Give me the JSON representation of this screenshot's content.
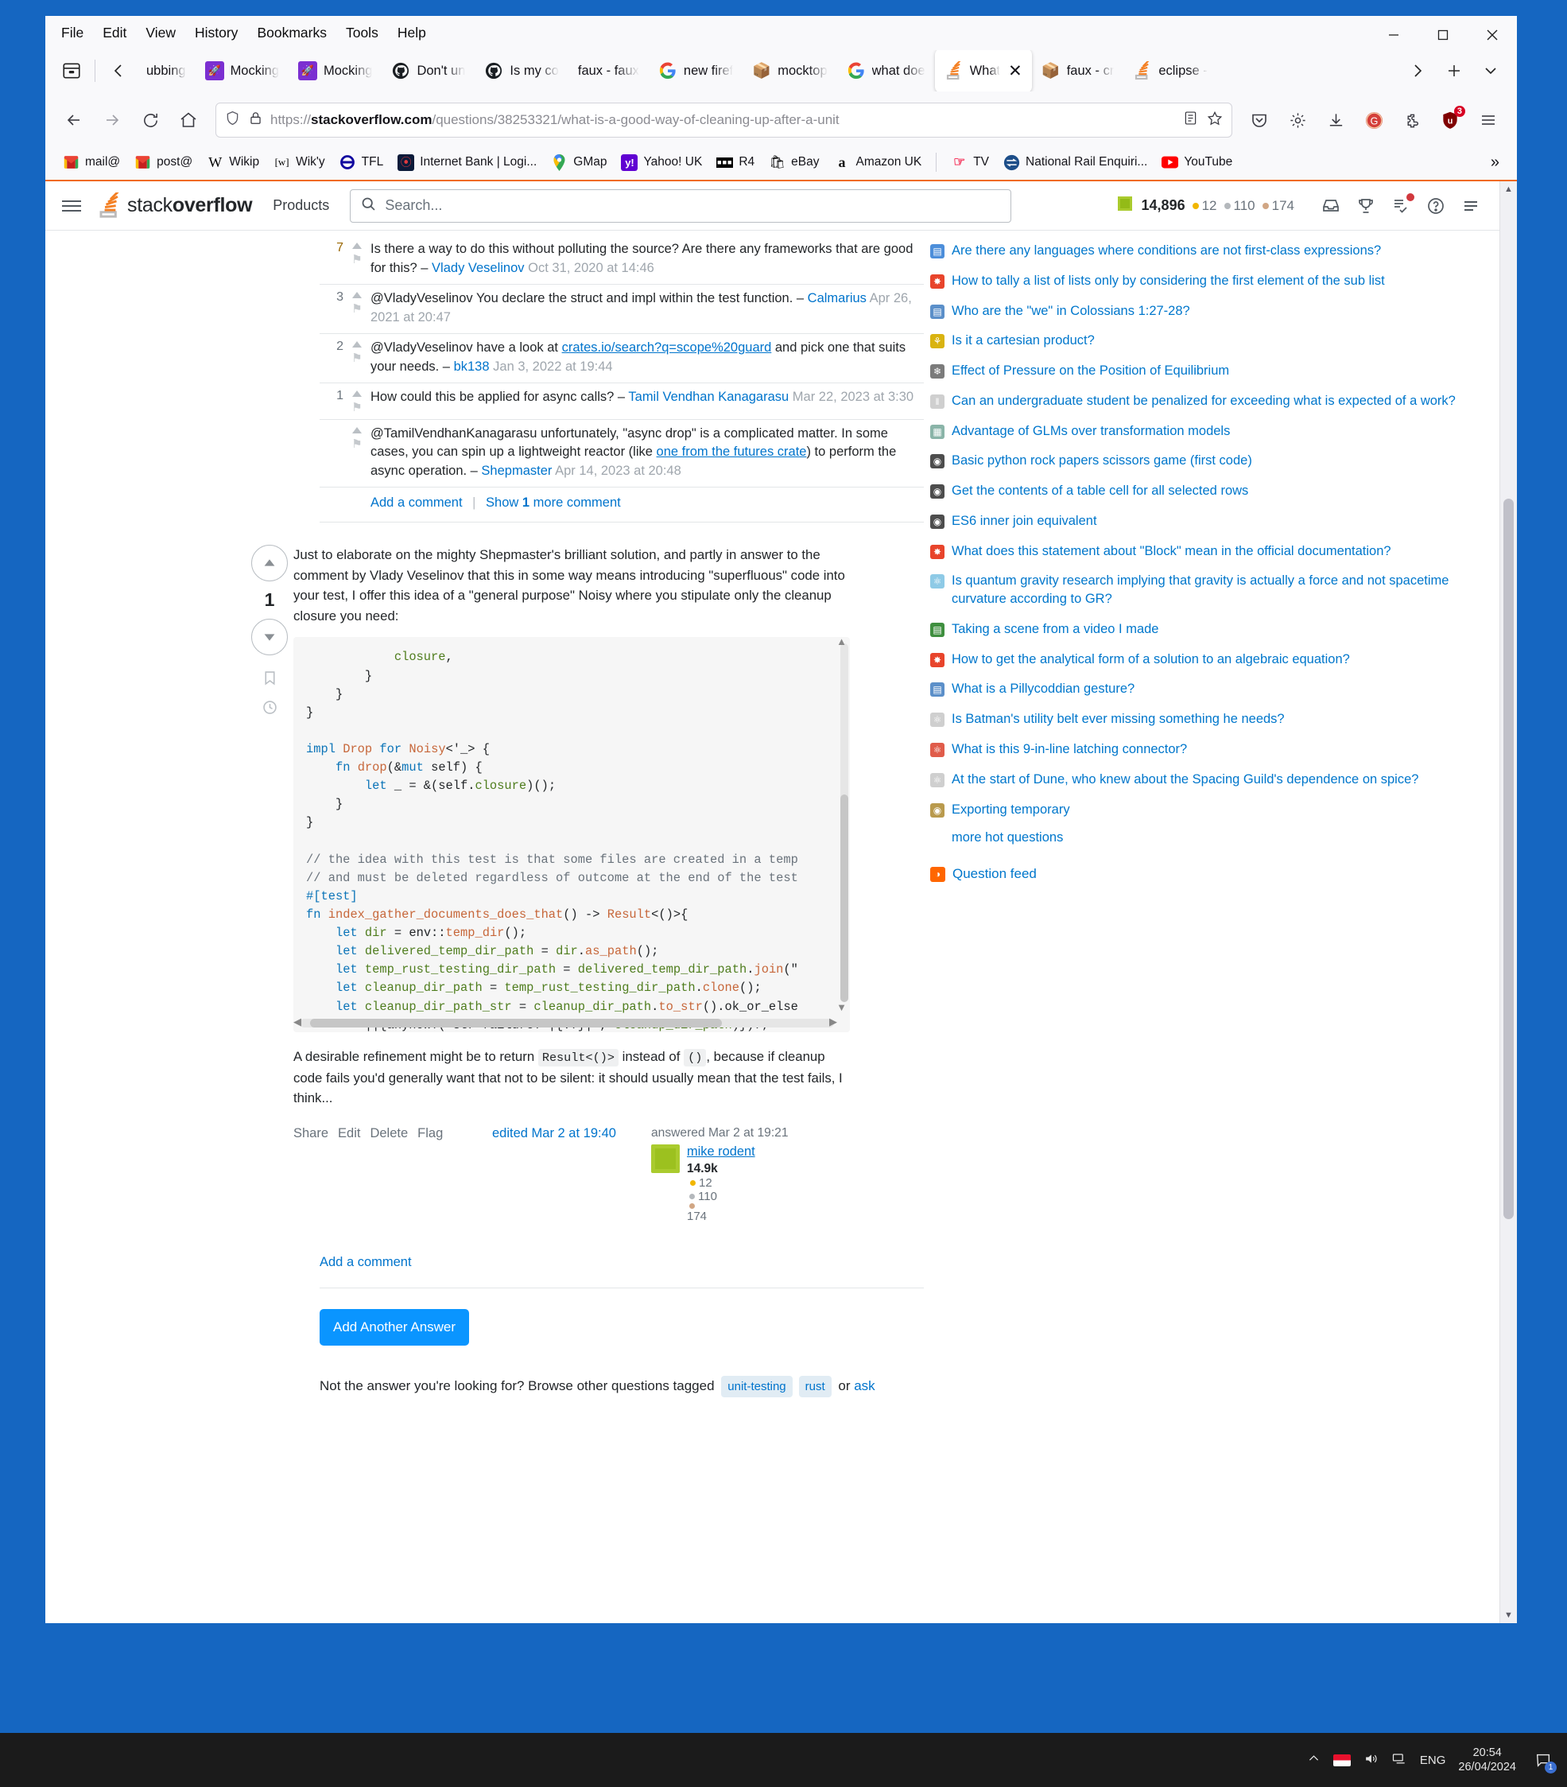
{
  "window": {
    "menu": [
      "File",
      "Edit",
      "View",
      "History",
      "Bookmarks",
      "Tools",
      "Help"
    ],
    "controls": {
      "minimize": "—",
      "maximize": "☐",
      "close": "✕"
    }
  },
  "tabs": [
    {
      "label": "ubbing",
      "icon": "none",
      "active": false
    },
    {
      "label": "Mocking",
      "icon": "rocket-purple",
      "active": false
    },
    {
      "label": "Mocking",
      "icon": "rocket-purple",
      "active": false
    },
    {
      "label": "Don't un",
      "icon": "github",
      "active": false
    },
    {
      "label": "Is my co",
      "icon": "github",
      "active": false
    },
    {
      "label": "faux - faux",
      "icon": "none",
      "active": false
    },
    {
      "label": "new firef",
      "icon": "google",
      "active": false
    },
    {
      "label": "mocktop",
      "icon": "package",
      "active": false
    },
    {
      "label": "what doe",
      "icon": "google",
      "active": false
    },
    {
      "label": "What",
      "icon": "stackoverflow",
      "active": true
    },
    {
      "label": "faux - cr",
      "icon": "package",
      "active": false
    },
    {
      "label": "eclipse -",
      "icon": "stackoverflow",
      "active": false
    }
  ],
  "tabstrip": {
    "list_all_tabs": "▼",
    "new_tab": "+",
    "scroll_left": "‹",
    "scroll_right": "›"
  },
  "navbar": {
    "back": "←",
    "forward": "→",
    "reload": "⟳",
    "home": "⌂",
    "url_scheme": "https://",
    "url_domain": "stackoverflow.com",
    "url_path": "/questions/38253321/what-is-a-good-way-of-cleaning-up-after-a-unit",
    "reader_icon": "reader-view-icon",
    "bookmark_star": "☆",
    "pocket": "save-to-pocket-icon",
    "settings": "gear-icon",
    "downloads": "download-icon",
    "account": "account-icon",
    "extensions": "extensions-icon",
    "ublock_badge": "3",
    "app_menu": "☰"
  },
  "bookmarks": [
    {
      "label": "mail@",
      "icon": "gmail"
    },
    {
      "label": "post@",
      "icon": "gmail"
    },
    {
      "label": "Wikip",
      "icon": "wikipedia"
    },
    {
      "label": "Wik'y",
      "icon": "wiktionary"
    },
    {
      "label": "TFL",
      "icon": "tfl"
    },
    {
      "label": "Internet Bank | Logi...",
      "icon": "bank"
    },
    {
      "label": "GMap",
      "icon": "gmaps"
    },
    {
      "label": "Yahoo! UK",
      "icon": "yahoo"
    },
    {
      "label": "R4",
      "icon": "bbc"
    },
    {
      "label": "eBay",
      "icon": "ebay"
    },
    {
      "label": "Amazon UK",
      "icon": "amazon"
    },
    {
      "label": "TV",
      "icon": "freeview"
    },
    {
      "label": "National Rail Enquiri...",
      "icon": "nationalrail"
    },
    {
      "label": "YouTube",
      "icon": "youtube"
    }
  ],
  "bookmarks_overflow": "»",
  "so_header": {
    "menu_icon": "hamburger-icon",
    "logo_text_1": "stack",
    "logo_text_2": "overflow",
    "products": "Products",
    "search_placeholder": "Search...",
    "reputation": "14,896",
    "badge_gold": "12",
    "badge_silver": "110",
    "badge_bronze": "174",
    "colors": {
      "gold": "#f1b600",
      "silver": "#b4b8bc",
      "bronze": "#d1a684",
      "accent": "#0a95ff"
    },
    "icons": [
      "inbox-icon",
      "trophy-icon",
      "review-queue-icon",
      "help-icon",
      "site-switcher-icon"
    ]
  },
  "comments": [
    {
      "score": "7",
      "html": "Is there a way to do this without polluting the source? Are there any frameworks that are good for this? &ndash; <a href=\"#\">Vlady Veselinov</a> <span class=\"dt\">Oct 31, 2020 at 14:46</span>",
      "highlight": true
    },
    {
      "score": "3",
      "html": "@VladyVeselinov You declare the struct and impl within the test function. &ndash; <a href=\"#\">Calmarius</a> <span class=\"dt\">Apr 26, 2021 at 20:47</span>",
      "highlight": false
    },
    {
      "score": "2",
      "html": "@VladyVeselinov have a look at <a class=\"u\" href=\"#\">crates.io/search?q=scope%20guard</a> and pick one that suits your needs. &ndash; <a href=\"#\">bk138</a> <span class=\"dt\">Jan 3, 2022 at 19:44</span>",
      "highlight": false
    },
    {
      "score": "1",
      "html": "How could this be applied for async calls? &ndash; <a href=\"#\">Tamil Vendhan Kanagarasu</a> <span class=\"dt\">Mar 22, 2023 at 3:30</span>",
      "highlight": false
    },
    {
      "score": "",
      "html": "@TamilVendhanKanagarasu unfortunately, \"async drop\" is a complicated matter. In some cases, you can spin up a lightweight reactor (like <a class=\"u\" href=\"#\">one from the futures crate</a>) to perform the async operation. &ndash; <a href=\"#\">Shepmaster</a> <span class=\"dt\">Apr 14, 2023 at 20:48</span>",
      "highlight": false
    }
  ],
  "comment_actions": {
    "add": "Add a comment",
    "show_more_prefix": "Show ",
    "show_more_count": "1",
    "show_more_suffix": " more comment"
  },
  "answer": {
    "vote_count": "1",
    "up_arrow": "▲",
    "down_arrow": "▼",
    "bookmark_icon": "bookmark-icon",
    "history_icon": "history-icon",
    "paragraph_1": "Just to elaborate on the mighty Shepmaster's brilliant solution, and partly in answer to the comment by Vlady Veselinov that this in some way means introducing \"superfluous\" code into your test, I offer this idea of a \"general purpose\" Noisy where you stipulate only the cleanup closure you need:",
    "code": "            closure,\n        }\n    }\n}\n\nimpl Drop for Noisy<'_> {\n    fn drop(&mut self) {\n        let _ = &(self.closure)();\n    }\n}\n\n// the idea with this test is that some files are created in a temp\n// and must be deleted regardless of outcome at the end of the test\n#[test]\nfn index_gather_documents_does_that() -> Result<()>{\n    let dir = env::temp_dir();\n    let delivered_temp_dir_path = dir.as_path();\n    let temp_rust_testing_dir_path = delivered_temp_dir_path.join(\"\n    let cleanup_dir_path = temp_rust_testing_dir_path.clone();\n    let cleanup_dir_path_str = cleanup_dir_path.to_str().ok_or_else\n        ||{anyhow!(\"str failure! |{:?}|\", cleanup_dir_path)})?;\n\n    let _ = Noisy::new(&||{\n        let _ = std::fs::remove_dir_all(cleanup_dir_path_str);\n    });\n\n    // ... test proper: start creating the files",
    "paragraph_2_pre": "A desirable refinement might be to return ",
    "paragraph_2_code1": "Result<()>",
    "paragraph_2_mid": " instead of ",
    "paragraph_2_code2": "()",
    "paragraph_2_post": ", because if cleanup code fails you'd generally want that not to be silent: it should usually mean that the test fails, I think...",
    "actions": [
      "Share",
      "Edit",
      "Delete",
      "Flag"
    ],
    "edited": "edited Mar 2 at 19:40",
    "answered": "answered Mar 2 at 19:21",
    "user_name": "mike rodent",
    "user_rep": "14.9k",
    "user_gold": "12",
    "user_silver": "110",
    "user_bronze": "174",
    "add_comment": "Add a comment"
  },
  "footer": {
    "add_another_answer": "Add Another Answer",
    "not_answer_prefix": "Not the answer you're looking for? Browse other questions tagged ",
    "tags": [
      "unit-testing",
      "rust"
    ],
    "not_answer_or": " or ",
    "ask": "ask"
  },
  "sidebar": {
    "hot_questions": [
      {
        "text": "Are there any languages where conditions are not first-class expressions?",
        "icon": "#4c8eda",
        "glyph": "▤"
      },
      {
        "text": "How to tally a list of lists only by considering the first element of the sub list",
        "icon": "#e8442b",
        "glyph": "✸"
      },
      {
        "text": "Who are the \"we\" in Colossians 1:27-28?",
        "icon": "#5b8fc9",
        "glyph": "▤"
      },
      {
        "text": "Is it a cartesian product?",
        "icon": "#d9b310",
        "glyph": "⚘"
      },
      {
        "text": "Effect of Pressure on the Position of Equilibrium",
        "icon": "#7b7b7b",
        "glyph": "❄"
      },
      {
        "text": "Can an undergraduate student be penalized for exceeding what is expected of a work?",
        "icon": "#cfcfcf",
        "glyph": "‖"
      },
      {
        "text": "Advantage of GLMs over transformation models",
        "icon": "#8ab4a8",
        "glyph": "▦"
      },
      {
        "text": "Basic python rock papers scissors game (first code)",
        "icon": "#4d4d4d",
        "glyph": "◉"
      },
      {
        "text": "Get the contents of a table cell for all selected rows",
        "icon": "#4d4d4d",
        "glyph": "◉"
      },
      {
        "text": "ES6 inner join equivalent",
        "icon": "#4d4d4d",
        "glyph": "◉"
      },
      {
        "text": "What does this statement about \"Block\" mean in the official documentation?",
        "icon": "#e8442b",
        "glyph": "✸"
      },
      {
        "text": "Is quantum gravity research implying that gravity is actually a force and not spacetime curvature according to GR?",
        "icon": "#8ecae6",
        "glyph": "⚛"
      },
      {
        "text": "Taking a scene from a video I made",
        "icon": "#3f8f3f",
        "glyph": "▤"
      },
      {
        "text": "How to get the analytical form of a solution to an algebraic equation?",
        "icon": "#e8442b",
        "glyph": "✸"
      },
      {
        "text": "What is a Pillycoddian gesture?",
        "icon": "#5b8fc9",
        "glyph": "▤"
      },
      {
        "text": "Is Batman's utility belt ever missing something he needs?",
        "icon": "#cfcfcf",
        "glyph": "⚛"
      },
      {
        "text": "What is this 9-in-line latching connector?",
        "icon": "#e05c4a",
        "glyph": "⚛"
      },
      {
        "text": "At the start of Dune, who knew about the Spacing Guild's dependence on spice?",
        "icon": "#cfcfcf",
        "glyph": "⚛"
      },
      {
        "text": "Exporting temporary",
        "icon": "#b99a4d",
        "glyph": "◉"
      }
    ],
    "more_hot": "more hot questions",
    "question_feed": "Question feed",
    "rss_icon": "rss-icon"
  },
  "taskbar": {
    "show_hidden": "⌃",
    "language": "ENG",
    "time": "20:54",
    "date": "26/04/2024",
    "notif_count": "1",
    "volume_icon": "speaker-icon",
    "network_icon": "network-icon"
  }
}
